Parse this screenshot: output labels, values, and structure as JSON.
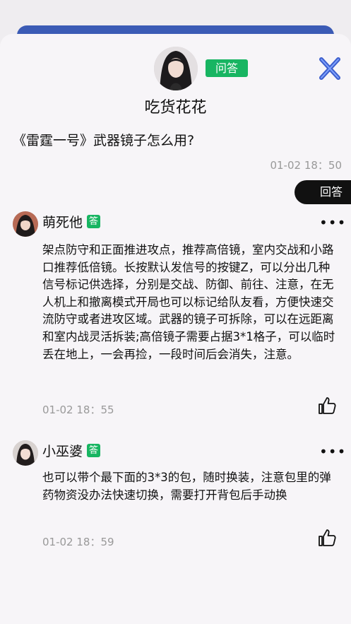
{
  "post": {
    "author_name": "吃货花花",
    "type_badge": "问答",
    "question": "《雷霆一号》武器镜子怎么用?",
    "time": "01-02 18：50",
    "reply_label": "回答",
    "icons": [
      "close-icon",
      "more-icon",
      "thumbs-up-icon"
    ]
  },
  "answers": [
    {
      "name": "萌死他",
      "badge": "答",
      "text": "架点防守和正面推进攻点，推荐高倍镜，室内交战和小路口推荐低倍镜。长按默认发信号的按键Z，可以分出几种信号标记供选择，分别是交战、防御、前往、注意，在无人机上和撤离模式开局也可以标记给队友看，方便快速交流防守或者进攻区域。武器的镜子可拆除，可以在远距离和室内战灵活拆装;高倍镜子需要占据3*1格子，可以临时丢在地上，一会再捡，一段时间后会消失，注意。",
      "time": "01-02 18：55",
      "more": "•••"
    },
    {
      "name": "小巫婆",
      "badge": "答",
      "text": "也可以带个最下面的3*3的包，随时换装，注意包里的弹药物资没办法快速切换，需要打开背包后手动换",
      "time": "01-02 18：59",
      "more": "•••"
    }
  ],
  "colors": {
    "accent_green": "#18b562",
    "top_bar": "#3b5bb5",
    "close_icon": "#3d5ecc"
  }
}
